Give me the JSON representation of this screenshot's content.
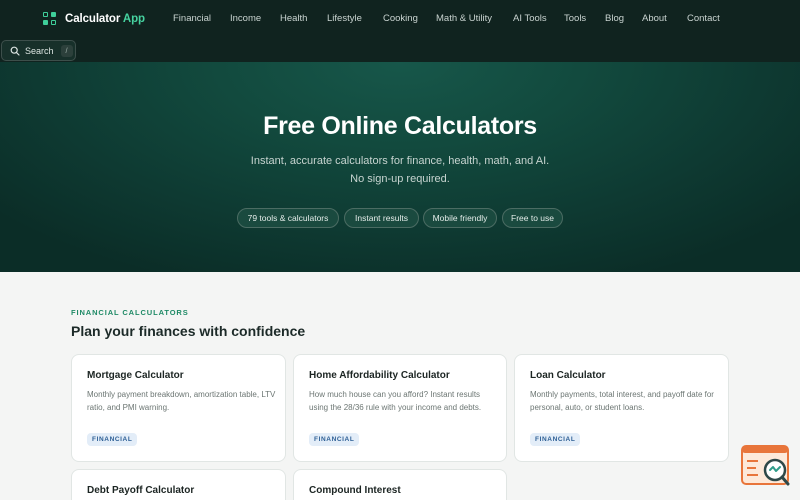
{
  "brand": {
    "name_part1": "Calculator",
    "name_part2": "App",
    "accent_color": "#46d3a0"
  },
  "nav": {
    "items": [
      "Financial",
      "Income",
      "Health",
      "Lifestyle",
      "Cooking",
      "Math & Utility",
      "AI Tools",
      "Tools",
      "Blog",
      "About",
      "Contact"
    ]
  },
  "search": {
    "label": "Search",
    "shortcut": "/"
  },
  "hero": {
    "title": "Free Online Calculators",
    "subtitle_line1": "Instant, accurate calculators for finance, health, math, and AI.",
    "subtitle_line2": "No sign-up required.",
    "pills": [
      "79 tools & calculators",
      "Instant results",
      "Mobile friendly",
      "Free to use"
    ]
  },
  "section": {
    "eyebrow": "FINANCIAL CALCULATORS",
    "title": "Plan your finances with confidence",
    "cards": [
      {
        "title": "Mortgage Calculator",
        "desc": "Monthly payment breakdown, amortization table, LTV ratio, and PMI warning.",
        "badge": "FINANCIAL"
      },
      {
        "title": "Home Affordability Calculator",
        "desc": "How much house can you afford? Instant results using the 28/36 rule with your income and debts.",
        "badge": "FINANCIAL"
      },
      {
        "title": "Loan Calculator",
        "desc": "Monthly payments, total interest, and payoff date for personal, auto, or student loans.",
        "badge": "FINANCIAL"
      },
      {
        "title": "Debt Payoff Calculator",
        "desc": "",
        "badge": ""
      },
      {
        "title": "Compound Interest",
        "desc": "",
        "badge": ""
      }
    ]
  },
  "colors": {
    "header_bg": "#10231f",
    "hero_bg": "#124a3e",
    "badge_bg": "#e3edf8",
    "badge_text": "#2d5f95"
  },
  "icons": {
    "search": "search-icon",
    "logo": "logo-grid-icon",
    "widget": "help-chat-icon"
  }
}
